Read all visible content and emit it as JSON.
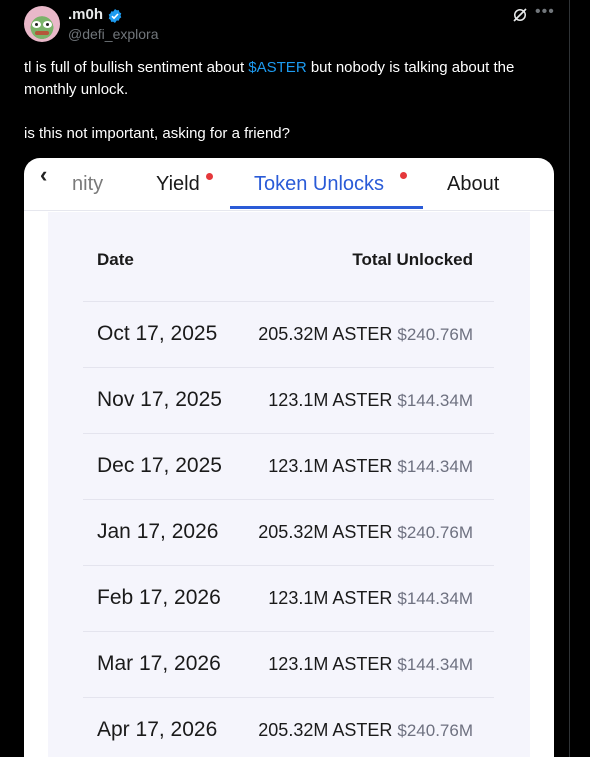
{
  "post": {
    "display_name": ".m0h",
    "handle": "@defi_explora",
    "text_before": "tl is full of bullish sentiment about ",
    "cashtag": "$ASTER",
    "text_after": " but nobody is talking about the monthly unlock.",
    "text_line2": "is this not important, asking for a friend?",
    "icons": [
      "grok-icon",
      "more-icon",
      "verified-badge-icon"
    ]
  },
  "media": {
    "tabs": [
      "nity",
      "Yield",
      "Token Unlocks",
      "About"
    ],
    "active_tab": "Token Unlocks",
    "table": {
      "header_date": "Date",
      "header_total": "Total Unlocked",
      "rows": [
        {
          "date": "Oct 17, 2025",
          "amount": "205.32M ASTER",
          "usd": "$240.76M"
        },
        {
          "date": "Nov 17, 2025",
          "amount": "123.1M ASTER",
          "usd": "$144.34M"
        },
        {
          "date": "Dec 17, 2025",
          "amount": "123.1M ASTER",
          "usd": "$144.34M"
        },
        {
          "date": "Jan 17, 2026",
          "amount": "205.32M ASTER",
          "usd": "$240.76M"
        },
        {
          "date": "Feb 17, 2026",
          "amount": "123.1M ASTER",
          "usd": "$144.34M"
        },
        {
          "date": "Mar 17, 2026",
          "amount": "123.1M ASTER",
          "usd": "$144.34M"
        },
        {
          "date": "Apr 17, 2026",
          "amount": "205.32M ASTER",
          "usd": "$240.76M"
        }
      ]
    }
  },
  "colors": {
    "accent": "#1d9bf0",
    "tab_active": "#2a5bd7",
    "dot": "#e5383b"
  }
}
